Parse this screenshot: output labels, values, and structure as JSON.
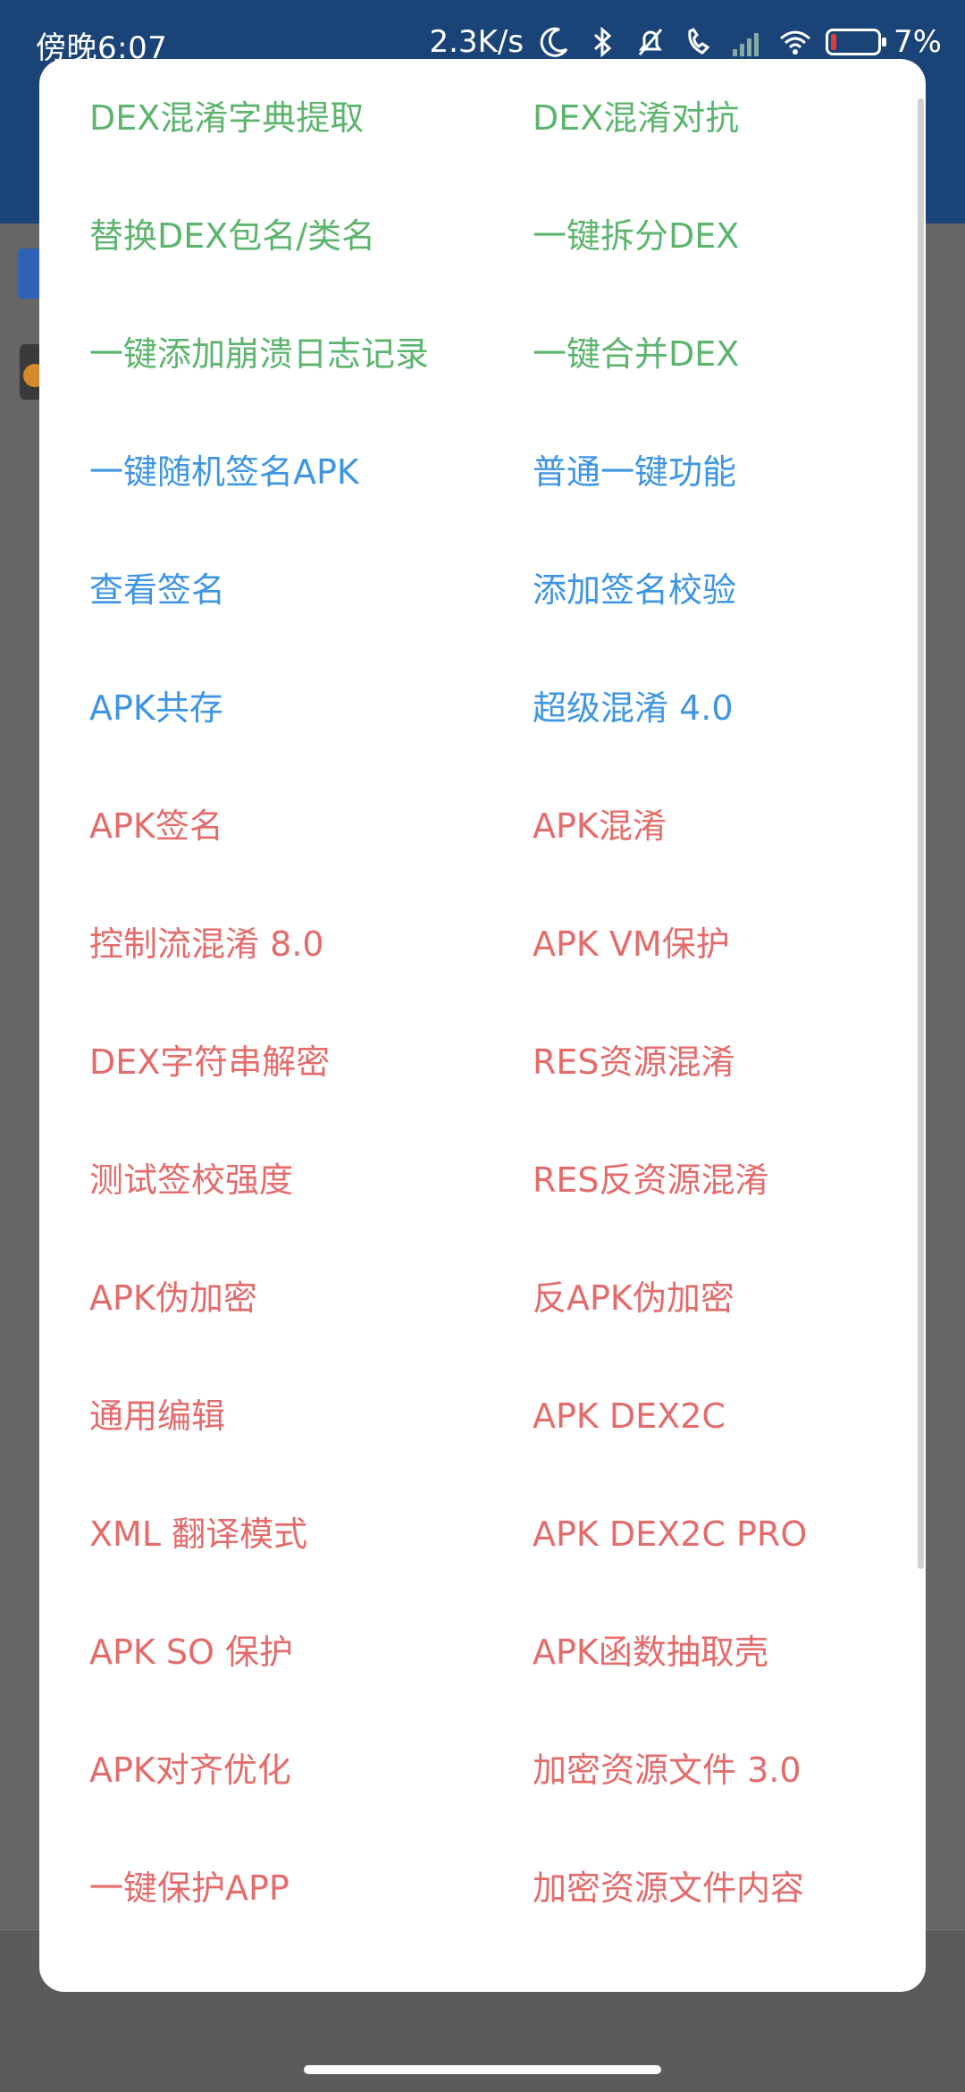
{
  "status_bar": {
    "time": "傍晚6:07",
    "speed": "2.3K/s",
    "battery": "7%",
    "icons": [
      "moon-icon",
      "bluetooth-icon",
      "bell-off-icon",
      "phone-icon",
      "signal-icon",
      "wifi-icon",
      "battery-icon"
    ]
  },
  "menu": {
    "rows": [
      {
        "left": {
          "label": "DEX混淆字典提取",
          "color": "green"
        },
        "right": {
          "label": "DEX混淆对抗",
          "color": "green"
        }
      },
      {
        "left": {
          "label": "替换DEX包名/类名",
          "color": "green"
        },
        "right": {
          "label": "一键拆分DEX",
          "color": "green"
        }
      },
      {
        "left": {
          "label": "一键添加崩溃日志记录",
          "color": "green"
        },
        "right": {
          "label": "一键合并DEX",
          "color": "green"
        }
      },
      {
        "left": {
          "label": "一键随机签名APK",
          "color": "blue"
        },
        "right": {
          "label": "普通一键功能",
          "color": "blue"
        }
      },
      {
        "left": {
          "label": "查看签名",
          "color": "blue"
        },
        "right": {
          "label": "添加签名校验",
          "color": "blue"
        }
      },
      {
        "left": {
          "label": "APK共存",
          "color": "blue"
        },
        "right": {
          "label": "超级混淆 4.0",
          "color": "blue"
        }
      },
      {
        "left": {
          "label": "APK签名",
          "color": "red"
        },
        "right": {
          "label": "APK混淆",
          "color": "red"
        }
      },
      {
        "left": {
          "label": "控制流混淆 8.0",
          "color": "red"
        },
        "right": {
          "label": "APK VM保护",
          "color": "red"
        }
      },
      {
        "left": {
          "label": "DEX字符串解密",
          "color": "red"
        },
        "right": {
          "label": "RES资源混淆",
          "color": "red"
        }
      },
      {
        "left": {
          "label": "测试签校强度",
          "color": "red"
        },
        "right": {
          "label": "RES反资源混淆",
          "color": "red"
        }
      },
      {
        "left": {
          "label": "APK伪加密",
          "color": "red"
        },
        "right": {
          "label": "反APK伪加密",
          "color": "red"
        }
      },
      {
        "left": {
          "label": "通用编辑",
          "color": "red"
        },
        "right": {
          "label": "APK DEX2C",
          "color": "red"
        }
      },
      {
        "left": {
          "label": "XML 翻译模式",
          "color": "red"
        },
        "right": {
          "label": "APK DEX2C PRO",
          "color": "red"
        }
      },
      {
        "left": {
          "label": "APK SO 保护",
          "color": "red"
        },
        "right": {
          "label": "APK函数抽取壳",
          "color": "red"
        }
      },
      {
        "left": {
          "label": "APK对齐优化",
          "color": "red"
        },
        "right": {
          "label": "加密资源文件 3.0",
          "color": "red"
        }
      },
      {
        "left": {
          "label": "一键保护APP",
          "color": "red"
        },
        "right": {
          "label": "加密资源文件内容",
          "color": "red"
        }
      }
    ]
  }
}
